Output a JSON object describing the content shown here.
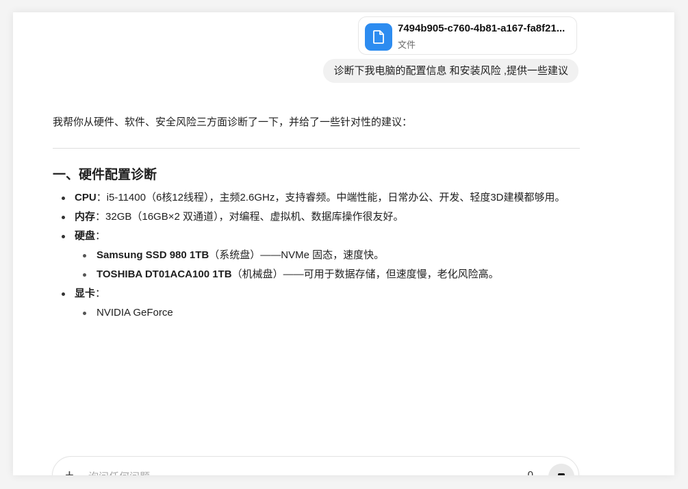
{
  "attachment": {
    "file_name": "7494b905-c760-4b81-a167-fa8f21...",
    "file_type": "文件",
    "icon": "document-icon"
  },
  "user_message": "诊断下我电脑的配置信息 和安装风险 ,提供一些建议",
  "assistant": {
    "intro": "我帮你从硬件、软件、安全风险三方面诊断了一下，并给了一些针对性的建议：",
    "section_title": "一、硬件配置诊断",
    "cpu": {
      "label": "CPU",
      "text": "：i5-11400（6核12线程），主频2.6GHz，支持睿频。中端性能，日常办公、开发、轻度3D建模都够用。"
    },
    "ram": {
      "label": "内存",
      "text": "：32GB（16GB×2 双通道），对编程、虚拟机、数据库操作很友好。"
    },
    "disk": {
      "label": "硬盘",
      "colon": "：",
      "items": [
        {
          "name": "Samsung SSD 980 1TB",
          "text": "（系统盘）——NVMe 固态，速度快。"
        },
        {
          "name": "TOSHIBA DT01ACA100 1TB",
          "text": "（机械盘）——可用于数据存储，但速度慢，老化风险高。"
        }
      ]
    },
    "gpu": {
      "label": "显卡",
      "colon": "：",
      "items": [
        {
          "text": "NVIDIA GeForce"
        }
      ]
    }
  },
  "composer": {
    "placeholder": "询问任何问题",
    "count": "0",
    "plus_icon": "plus-icon",
    "stop_icon": "stop-icon"
  }
}
